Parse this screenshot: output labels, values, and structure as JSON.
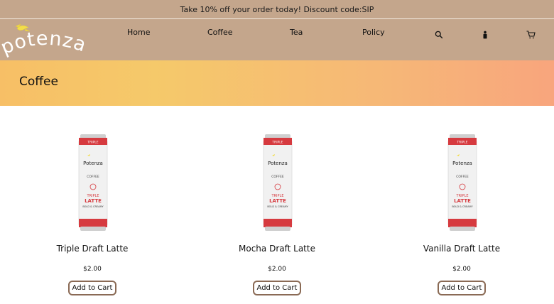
{
  "announcement": "Take 10% off your order today! Discount code:SIP",
  "brand": {
    "logo_text": "potenza"
  },
  "nav": {
    "links": [
      "Home",
      "Coffee",
      "Tea",
      "Policy"
    ],
    "icons": [
      "search-icon",
      "user-icon",
      "cart-icon"
    ]
  },
  "hero": {
    "title": "Coffee"
  },
  "can_print": {
    "top_band": "TRIPLE",
    "brand": "Potenza",
    "kind": "COFFEE",
    "line1": "TRIPLE",
    "line2": "LATTE",
    "line3": "BOLD & CREAMY"
  },
  "products": [
    {
      "name": "Triple Draft Latte",
      "price": "$2.00",
      "button": "Add to Cart"
    },
    {
      "name": "Mocha Draft Latte",
      "price": "$2.00",
      "button": "Add to Cart"
    },
    {
      "name": "Vanilla Draft Latte",
      "price": "$2.00",
      "button": "Add to Cart"
    }
  ],
  "colors": {
    "header_bg": "#c4a68c",
    "hero_gradient_start": "#f7bf66",
    "hero_gradient_end": "#f8a57d",
    "can_red": "#d63a3f",
    "button_border": "#8a6a55"
  }
}
